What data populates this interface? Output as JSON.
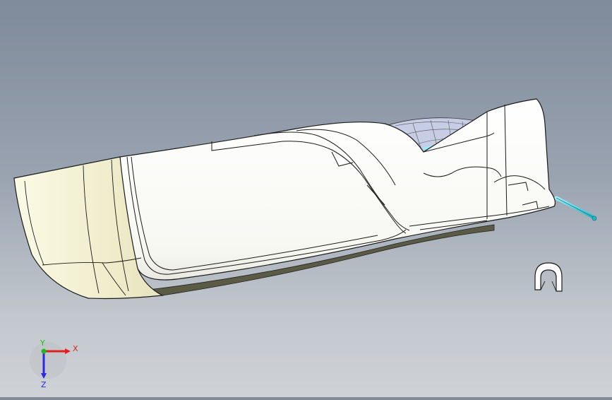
{
  "viewport": {
    "background_top": "#7f8a9a",
    "background_bottom": "#cfd2d6"
  },
  "model": {
    "body_color": "#ffffff",
    "end_cap_color": "#f2f0d2",
    "edge_color": "#1a1a1a",
    "rod_color": "#39d0e0",
    "clip_color": "#ffffff"
  },
  "triad": {
    "x_label": "X",
    "y_label": "Y",
    "z_label": "Z",
    "x_color": "#e02020",
    "y_color": "#1fb81f",
    "z_color": "#2a2ae0"
  }
}
